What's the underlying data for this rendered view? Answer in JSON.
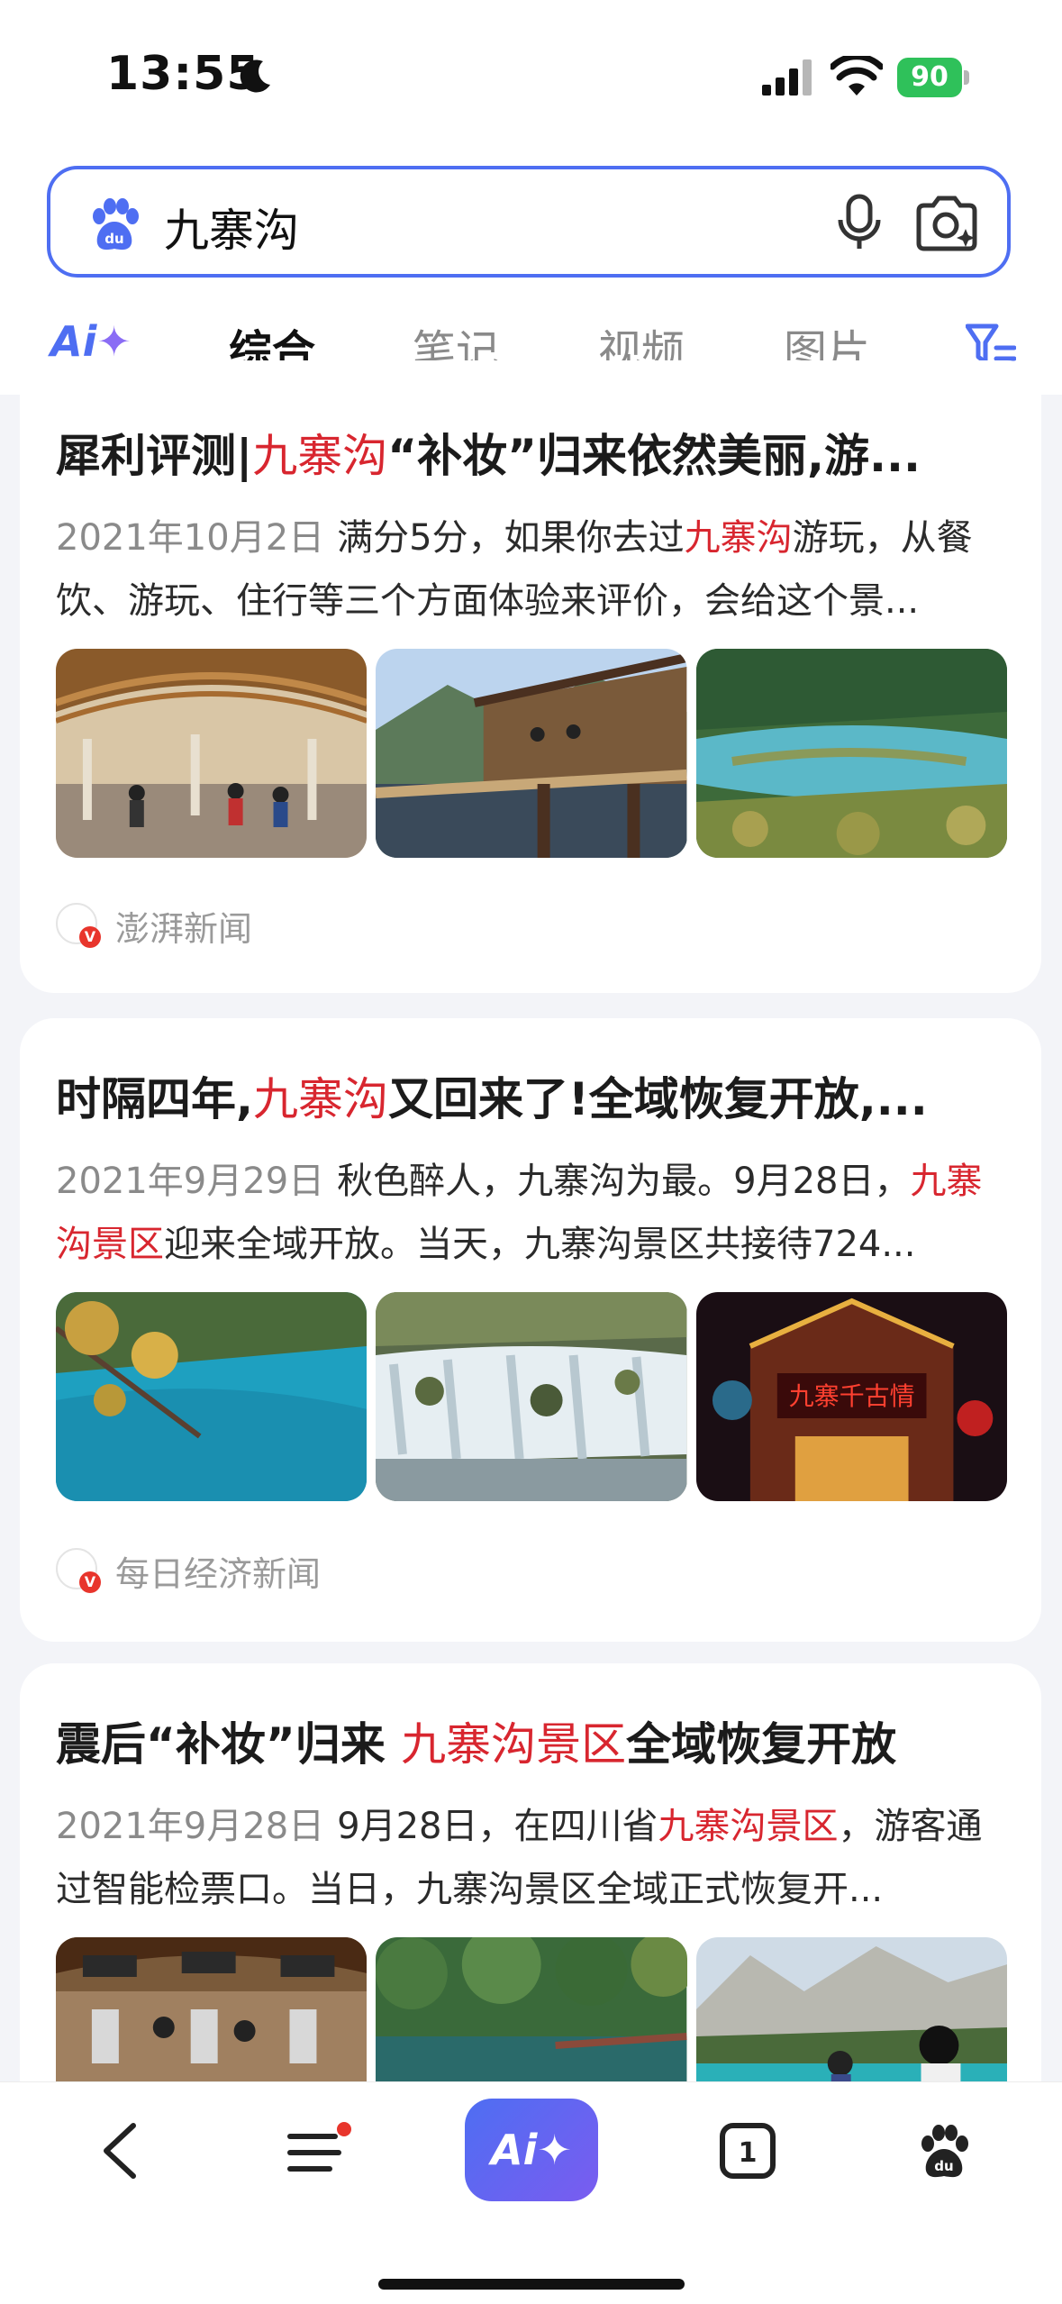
{
  "status": {
    "time": "13:55",
    "battery": "90"
  },
  "search": {
    "query": "九寨沟"
  },
  "tabs": {
    "ai": "Ai",
    "items": [
      "综合",
      "笔记",
      "视频",
      "图片"
    ]
  },
  "results": [
    {
      "title_pre": "犀利评测|",
      "title_hl": "九寨沟",
      "title_post": "“补妆”归来依然美丽,游...",
      "date": "2021年10月2日",
      "desc_pre": "满分5分，如果你去过",
      "desc_hl": "九寨沟",
      "desc_post": "游玩，从餐饮、游玩、住行等三个方面体验来评价，会给这个景...",
      "source": "澎湃新闻"
    },
    {
      "title_pre": "时隔四年,",
      "title_hl": "九寨沟",
      "title_post": "又回来了!全域恢复开放,...",
      "date": "2021年9月29日",
      "desc_pre": "秋色醉人，九寨沟为最。9月28日，",
      "desc_hl": "九寨沟景区",
      "desc_post": "迎来全域开放。当天，九寨沟景区共接待724...",
      "source": "每日经济新闻",
      "sign_text": "九寨千古情"
    },
    {
      "title_pre": "震后“补妆”归来 ",
      "title_hl": "九寨沟景区",
      "title_post": "全域恢复开放",
      "date": "2021年9月28日",
      "desc_pre": "9月28日，在四川省",
      "desc_hl": "九寨沟景区",
      "desc_post": "，游客通过智能检票口。当日，九寨沟景区全域正式恢复开...",
      "source": ""
    }
  ],
  "bottom": {
    "ai_label": "Ai",
    "tab_count": "1"
  },
  "colors": {
    "accent": "#4e6ef2",
    "highlight": "#d8262f"
  }
}
